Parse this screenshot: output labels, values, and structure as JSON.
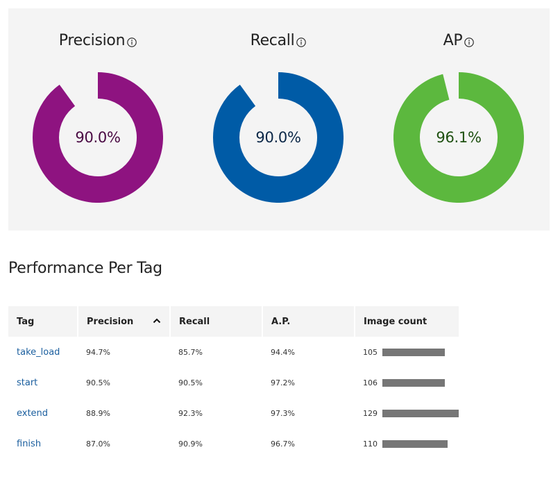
{
  "metrics": [
    {
      "title": "Precision",
      "value_text": "90.0%",
      "value": 90.0,
      "color": "#8e1380",
      "text_color": "#4a0a43",
      "icon": "info-icon"
    },
    {
      "title": "Recall",
      "value_text": "90.0%",
      "value": 90.0,
      "color": "#005ba6",
      "text_color": "#0b2747",
      "icon": "info-icon"
    },
    {
      "title": "AP",
      "value_text": "96.1%",
      "value": 96.1,
      "color": "#5cb83e",
      "text_color": "#1e5010",
      "icon": "info-icon"
    }
  ],
  "section_title": "Performance Per Tag",
  "table": {
    "columns": [
      "Tag",
      "Precision",
      "Recall",
      "A.P.",
      "Image count"
    ],
    "sorted_column": "Precision",
    "sort_icon": "chevron-up-icon",
    "bar_color": "#767676",
    "rows": [
      {
        "tag": "take_load",
        "precision": "94.7%",
        "recall": "85.7%",
        "ap": "94.4%",
        "count": "105",
        "count_value": 105
      },
      {
        "tag": "start",
        "precision": "90.5%",
        "recall": "90.5%",
        "ap": "97.2%",
        "count": "106",
        "count_value": 106
      },
      {
        "tag": "extend",
        "precision": "88.9%",
        "recall": "92.3%",
        "ap": "97.3%",
        "count": "129",
        "count_value": 129
      },
      {
        "tag": "finish",
        "precision": "87.0%",
        "recall": "90.9%",
        "ap": "96.7%",
        "count": "110",
        "count_value": 110
      }
    ]
  }
}
